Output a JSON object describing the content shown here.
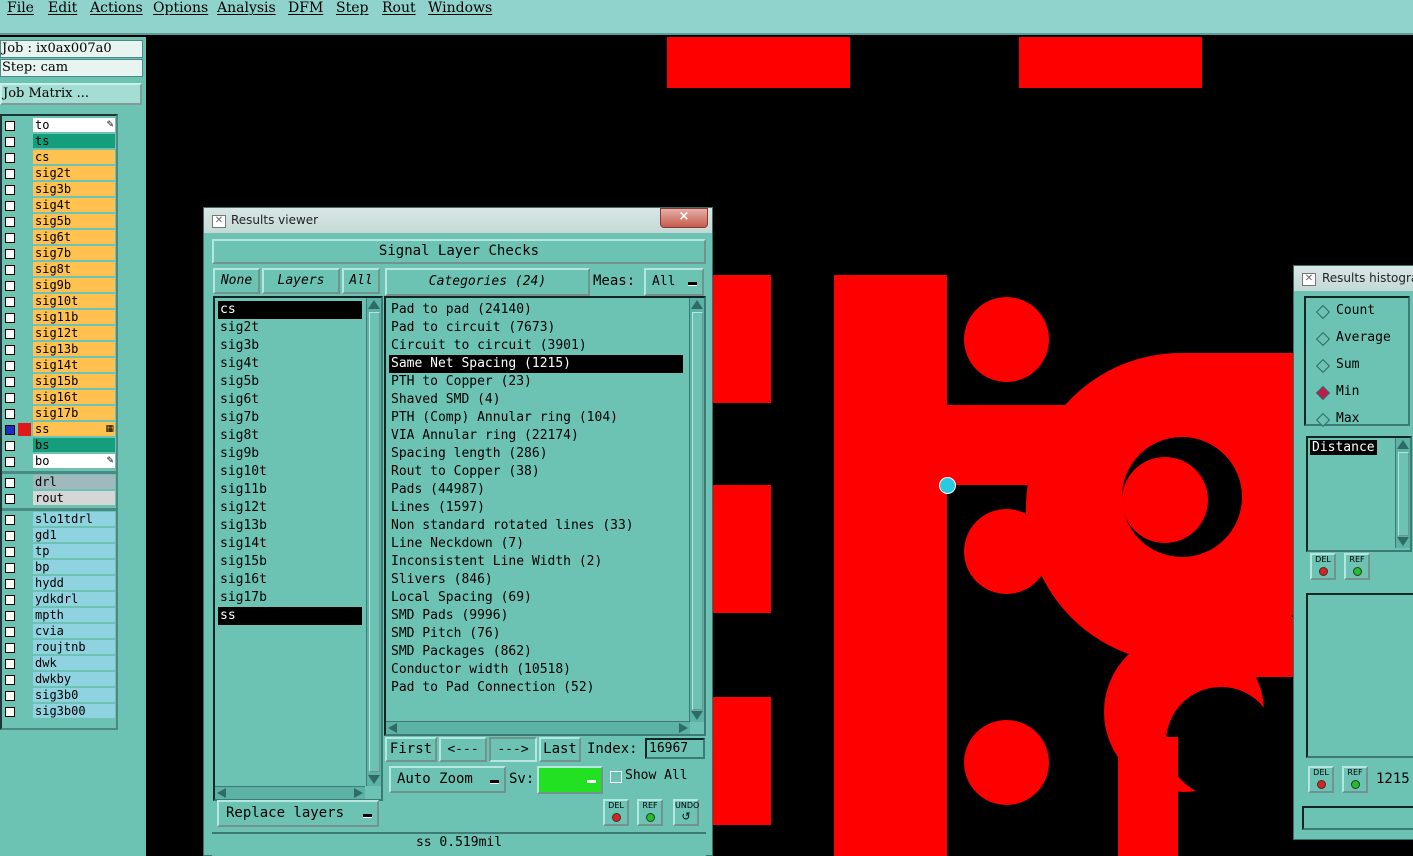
{
  "menu": [
    "File",
    "Edit",
    "Actions",
    "Options",
    "Analysis",
    "DFM",
    "Step",
    "Rout",
    "Windows"
  ],
  "job": {
    "job_label": "Job : ix0ax007a0",
    "step_label": "Step: cam",
    "matrix_button": "Job Matrix ..."
  },
  "layers": [
    {
      "name": "to",
      "color": "#ffffff",
      "mark": "pen"
    },
    {
      "name": "ts",
      "color": "#159e7c"
    },
    {
      "name": "cs",
      "color": "#ffc14f"
    },
    {
      "name": "sig2t",
      "color": "#ffc14f"
    },
    {
      "name": "sig3b",
      "color": "#ffc14f"
    },
    {
      "name": "sig4t",
      "color": "#ffc14f"
    },
    {
      "name": "sig5b",
      "color": "#ffc14f"
    },
    {
      "name": "sig6t",
      "color": "#ffc14f"
    },
    {
      "name": "sig7b",
      "color": "#ffc14f"
    },
    {
      "name": "sig8t",
      "color": "#ffc14f"
    },
    {
      "name": "sig9b",
      "color": "#ffc14f"
    },
    {
      "name": "sig10t",
      "color": "#ffc14f"
    },
    {
      "name": "sig11b",
      "color": "#ffc14f"
    },
    {
      "name": "sig12t",
      "color": "#ffc14f"
    },
    {
      "name": "sig13b",
      "color": "#ffc14f"
    },
    {
      "name": "sig14t",
      "color": "#ffc14f"
    },
    {
      "name": "sig15b",
      "color": "#ffc14f"
    },
    {
      "name": "sig16t",
      "color": "#ffc14f"
    },
    {
      "name": "sig17b",
      "color": "#ffc14f"
    },
    {
      "name": "ss",
      "color": "#ffc14f",
      "active": true,
      "mark": "grid"
    },
    {
      "name": "bs",
      "color": "#159e7c"
    },
    {
      "name": "bo",
      "color": "#ffffff",
      "mark": "pen"
    },
    {
      "name": "drl",
      "color": "#9fb9bc",
      "sep_before": true
    },
    {
      "name": "rout",
      "color": "#d6d6d6"
    },
    {
      "name": "slo1tdrl",
      "color": "#8fd3e0",
      "sep_before": true
    },
    {
      "name": "gd1",
      "color": "#8fd3e0"
    },
    {
      "name": "tp",
      "color": "#8fd3e0"
    },
    {
      "name": "bp",
      "color": "#8fd3e0"
    },
    {
      "name": "hydd",
      "color": "#8fd3e0"
    },
    {
      "name": "ydkdrl",
      "color": "#8fd3e0"
    },
    {
      "name": "mpth",
      "color": "#8fd3e0"
    },
    {
      "name": "cvia",
      "color": "#8fd3e0"
    },
    {
      "name": "roujtnb",
      "color": "#8fd3e0"
    },
    {
      "name": "dwk",
      "color": "#8fd3e0"
    },
    {
      "name": "dwkby",
      "color": "#8fd3e0"
    },
    {
      "name": "sig3b0",
      "color": "#8fd3e0"
    },
    {
      "name": "sig3b00",
      "color": "#8fd3e0"
    }
  ],
  "results_viewer": {
    "title": "Results viewer",
    "close": "×",
    "header": "Signal Layer Checks",
    "none_btn": "None",
    "layers_btn": "Layers",
    "all_btn": "All",
    "categories_btn": "Categories (24)",
    "meas_label": "Meas:",
    "meas_value": "All",
    "layer_items": [
      "cs",
      "sig2t",
      "sig3b",
      "sig4t",
      "sig5b",
      "sig6t",
      "sig7b",
      "sig8t",
      "sig9b",
      "sig10t",
      "sig11b",
      "sig12t",
      "sig13b",
      "sig14t",
      "sig15b",
      "sig16t",
      "sig17b",
      "ss"
    ],
    "selected_layers": [
      "cs",
      "ss"
    ],
    "categories": [
      "Pad to pad (24140)",
      "Pad to circuit (7673)",
      "Circuit to circuit (3901)",
      "Same Net Spacing (1215)",
      "PTH to Copper (23)",
      "Shaved SMD (4)",
      "PTH (Comp) Annular ring (104)",
      "VIA Annular ring (22174)",
      "Spacing length (286)",
      "Rout to Copper (38)",
      "Pads (44987)",
      "Lines (1597)",
      "Non standard rotated lines (33)",
      "Line Neckdown (7)",
      "Inconsistent Line Width (2)",
      "Slivers (846)",
      "Local Spacing (69)",
      "SMD Pads (9996)",
      "SMD Pitch (76)",
      "SMD Packages (862)",
      "Conductor width (10518)",
      "Pad to Pad Connection (52)"
    ],
    "selected_category": "Same Net Spacing (1215)",
    "first_btn": "First",
    "prev_btn": "<---",
    "next_btn": "--->",
    "last_btn": "Last",
    "index_label": "Index:",
    "index_value": "16967",
    "auto_zoom_btn": "Auto Zoom",
    "sv_label": "Sv:",
    "sv_color": "#22e022",
    "show_all_label": "Show All",
    "replace_layers_btn": "Replace layers",
    "del_btn": "DEL",
    "ref_btn": "REF",
    "undo_btn": "UNDO",
    "status": "ss 0.519mil"
  },
  "histogram": {
    "title": "Results histogra",
    "options": [
      "Count",
      "Average",
      "Sum",
      "Min",
      "Max"
    ],
    "selected_option": "Min",
    "list_item": "Distance",
    "del_btn": "DEL",
    "ref_btn": "REF",
    "value": "1215"
  },
  "colors": {
    "panel": "#6cc2b3",
    "copper": "#ff0000",
    "canvas": "#000000",
    "menu": "#8fd3cc"
  }
}
